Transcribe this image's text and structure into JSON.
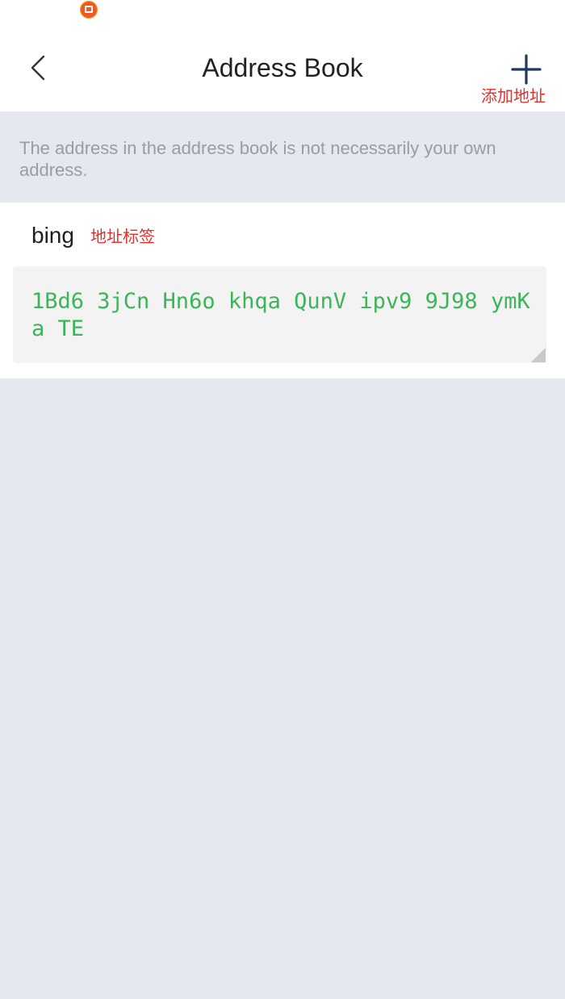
{
  "status_bar": {
    "notification_icon": "orange-app-badge-icon"
  },
  "header": {
    "title": "Address Book",
    "back_icon": "chevron-left-icon",
    "add_icon": "plus-icon",
    "add_annotation": "添加地址"
  },
  "notice": {
    "text": "The address in the address book is not necessarily your own address."
  },
  "entries": [
    {
      "label": "bing",
      "label_annotation": "地址标签",
      "address": "1Bd6 3jCn Hn6o khqa QunV ipv9 9J98 ymKa TE"
    }
  ],
  "colors": {
    "background": "#e5e8ef",
    "annotation": "#e0302b",
    "address": "#3cb55a",
    "add_icon": "#1f3864"
  }
}
